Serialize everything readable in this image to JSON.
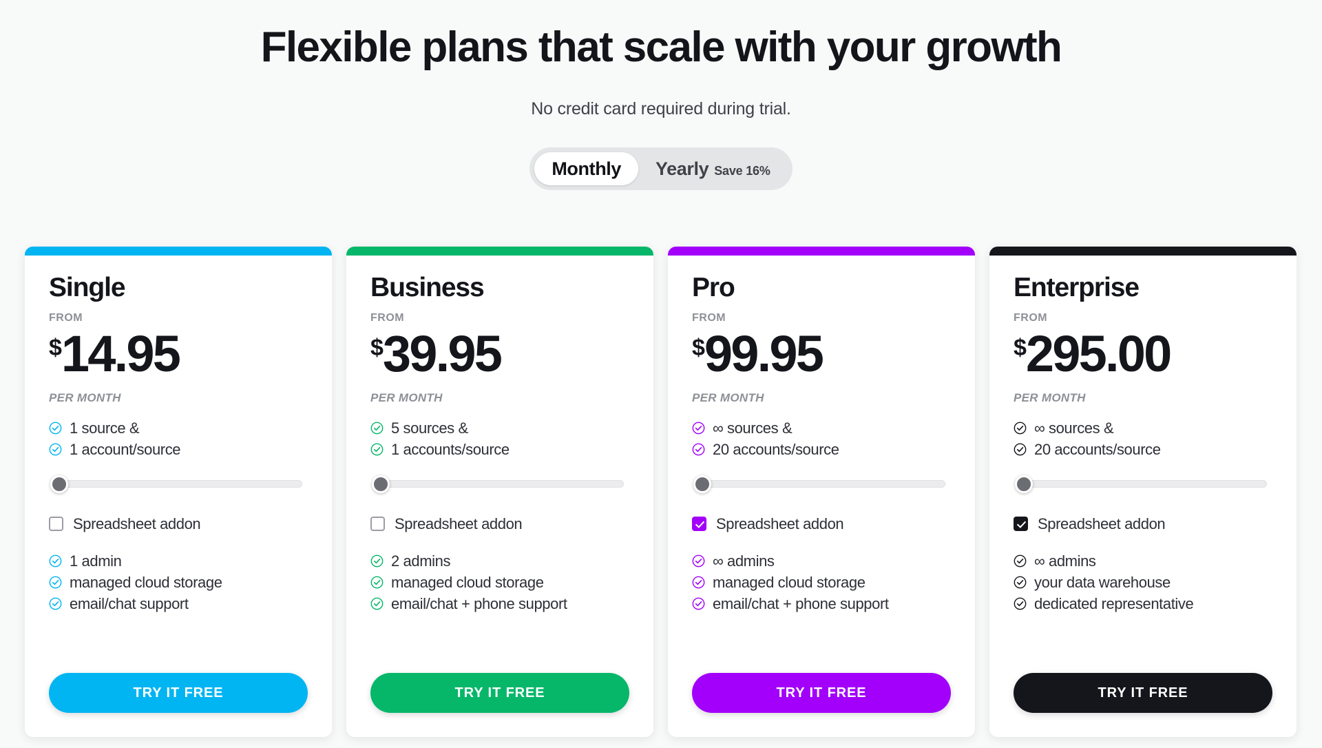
{
  "header": {
    "headline": "Flexible plans that scale with your growth",
    "subhead": "No credit card required during trial."
  },
  "billing_toggle": {
    "monthly_label": "Monthly",
    "yearly_label": "Yearly",
    "save_label": "Save 16%",
    "selected": "Monthly"
  },
  "labels": {
    "from": "FROM",
    "per_month": "PER MONTH",
    "addon": "Spreadsheet addon",
    "cta": "TRY IT FREE",
    "currency": "$"
  },
  "colors": {
    "single": "#00b5f2",
    "business": "#06b76a",
    "pro": "#a200fb",
    "enterprise": "#15161b",
    "page_background": "#f8f9f9",
    "card_background": "#ffffff",
    "slider_thumb": "#6b6d73",
    "slider_track": "#ececee"
  },
  "plans": [
    {
      "name": "Single",
      "accent": "#00b5f2",
      "price": "14.95",
      "slider_value": 0,
      "addon_checked": false,
      "features_top": [
        "1 source &",
        "1 account/source"
      ],
      "features_bottom": [
        "1 admin",
        "managed cloud storage",
        "email/chat support"
      ]
    },
    {
      "name": "Business",
      "accent": "#06b76a",
      "price": "39.95",
      "slider_value": 0,
      "addon_checked": false,
      "features_top": [
        "5 sources &",
        "1 accounts/source"
      ],
      "features_bottom": [
        "2 admins",
        "managed cloud storage",
        "email/chat + phone support"
      ]
    },
    {
      "name": "Pro",
      "accent": "#a200fb",
      "price": "99.95",
      "slider_value": 0,
      "addon_checked": true,
      "features_top": [
        "∞ sources &",
        "20 accounts/source"
      ],
      "features_bottom": [
        "∞ admins",
        "managed cloud storage",
        "email/chat + phone support"
      ]
    },
    {
      "name": "Enterprise",
      "accent": "#15161b",
      "price": "295.00",
      "slider_value": 0,
      "addon_checked": true,
      "features_top": [
        "∞ sources &",
        "20 accounts/source"
      ],
      "features_bottom": [
        "∞ admins",
        "your data warehouse",
        "dedicated representative"
      ]
    }
  ]
}
